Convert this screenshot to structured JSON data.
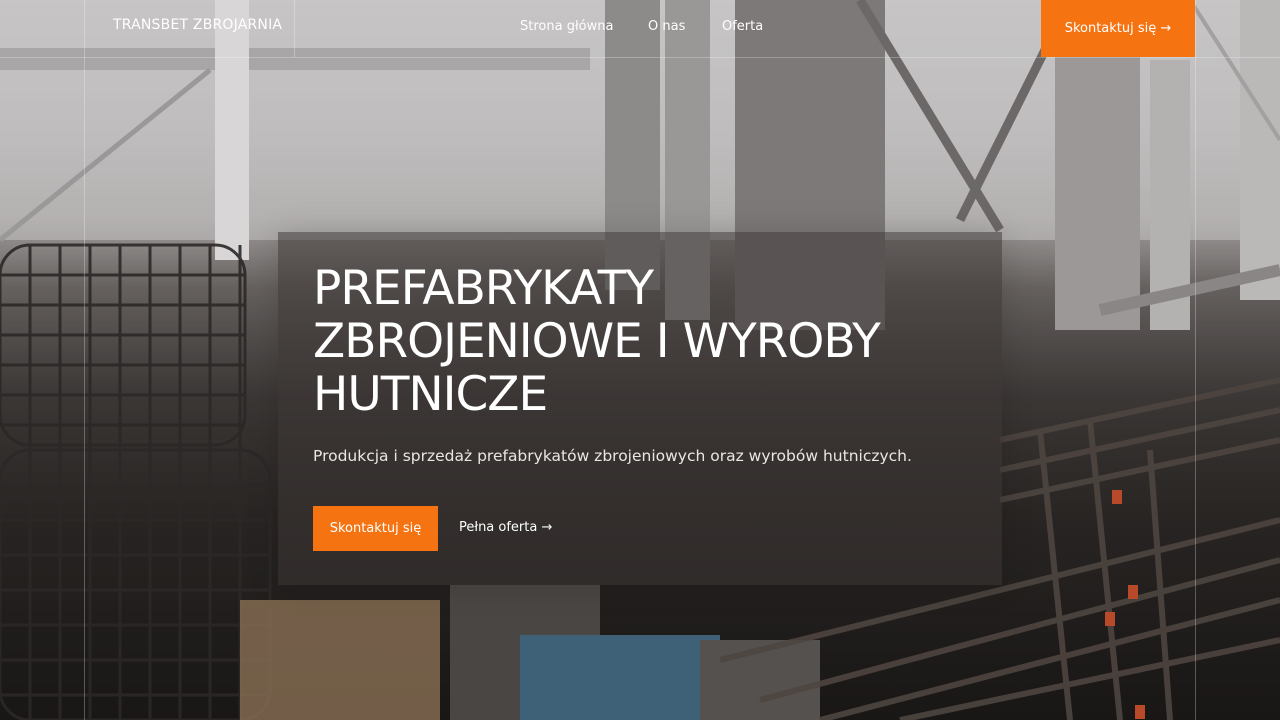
{
  "header": {
    "logo": "TRANSBET ZBROJARNIA",
    "nav": [
      {
        "label": "Strona główna"
      },
      {
        "label": "O nas"
      },
      {
        "label": "Oferta"
      }
    ],
    "cta_label": "Skontaktuj się →"
  },
  "hero": {
    "title": "PREFABRYKATY ZBROJENIOWE I WYROBY HUTNICZE",
    "subtitle": "Produkcja i sprzedaż prefabrykatów zbrojeniowych oraz wyrobów hutniczych.",
    "primary_cta": "Skontaktuj się",
    "secondary_link": "Pełna oferta →"
  },
  "colors": {
    "accent": "#f57411",
    "text": "#ffffff"
  }
}
